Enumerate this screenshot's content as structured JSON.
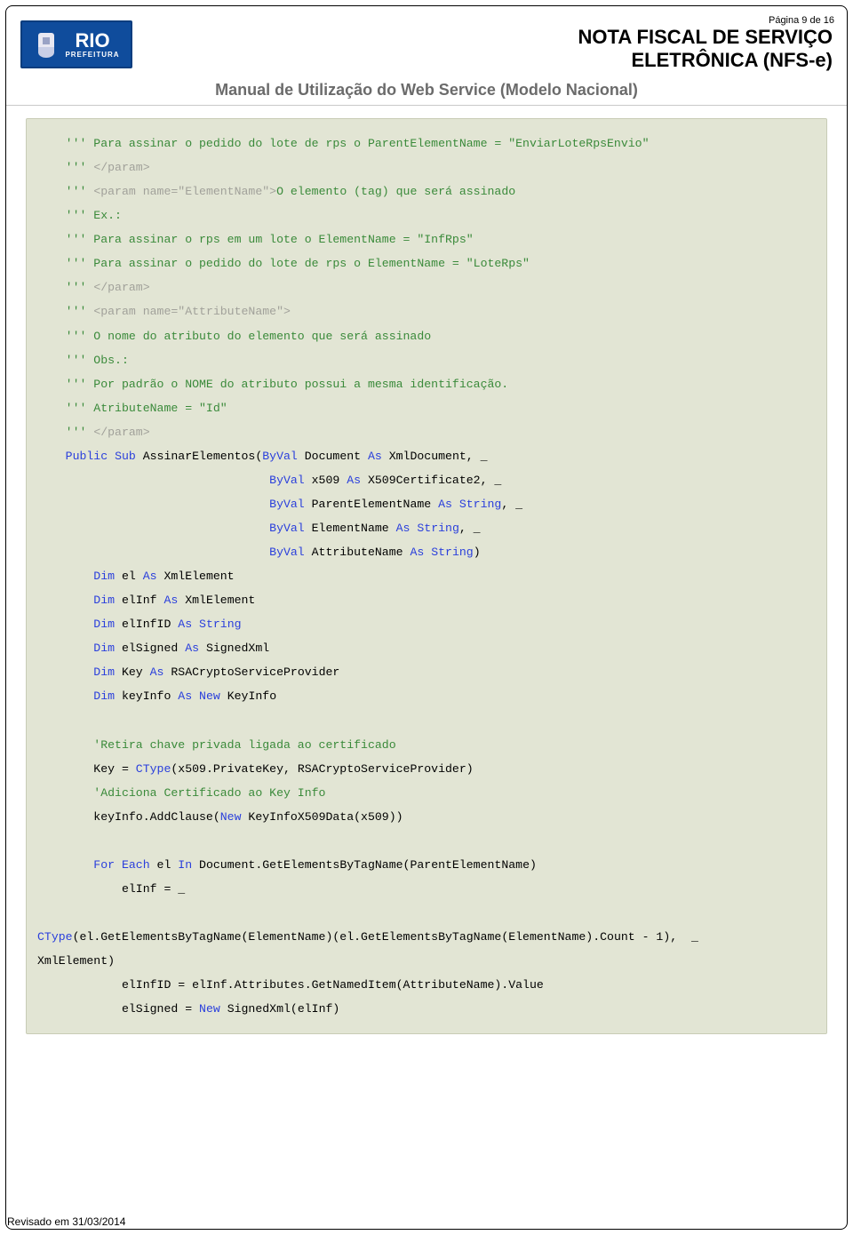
{
  "page_label": "Página 9 de 16",
  "logo": {
    "rio": "RIO",
    "pref": "PREFEITURA"
  },
  "title": {
    "line1": "NOTA FISCAL DE SERVIÇO",
    "line2": "ELETRÔNICA (NFS-e)"
  },
  "subtitle": "Manual de Utilização do Web Service (Modelo Nacional)",
  "footer": "Revisado em 31/03/2014",
  "code": {
    "l01": "    ''' Para assinar o pedido do lote de rps o ParentElementName = \"EnviarLoteRpsEnvio\"",
    "l02a": "    '''",
    "l02b": " </param>",
    "l03a": "    '''",
    "l03b": " <param name=\"ElementName\">",
    "l03c": "O elemento (tag) que será assinado",
    "l04": "    ''' Ex.:",
    "l05": "    ''' Para assinar o rps em um lote o ElementName = \"InfRps\"",
    "l06": "    ''' Para assinar o pedido do lote de rps o ElementName = \"LoteRps\"",
    "l07a": "    '''",
    "l07b": " </param>",
    "l08a": "    '''",
    "l08b": " <param name=\"AttributeName\">",
    "l09": "    ''' O nome do atributo do elemento que será assinado",
    "l10": "    ''' Obs.:",
    "l11": "    ''' Por padrão o NOME do atributo possui a mesma identificação.",
    "l12": "    ''' AtributeName = \"Id\"",
    "l13a": "    '''",
    "l13b": " </param>",
    "kw_public": "    Public",
    "kw_sub": "Sub",
    "sig_name": " AssinarElementos(",
    "kw_byval": "ByVal",
    "kw_as": "As",
    "sig_doc1": " Document ",
    "sig_doc2": " XmlDocument, _",
    "indent_sig": "                                 ",
    "sig_x509a": " x509 ",
    "sig_x509b": " X509Certificate2, _",
    "sig_p1": " ParentElementName ",
    "kw_string": "String",
    "sig_tail": ", _",
    "sig_e1": " ElementName ",
    "sig_a1": " AttributeName ",
    "sig_close": ")",
    "kw_dim": "        Dim",
    "d1a": " el ",
    "d1b": " XmlElement",
    "d2a": " elInf ",
    "d3a": " elInfID ",
    "d4a": " elSigned ",
    "d4b": " SignedXml",
    "d5a": " Key ",
    "d5b": " RSACryptoServiceProvider",
    "d6a": " keyInfo ",
    "kw_new": "New",
    "d6b": " KeyInfo",
    "blank": "",
    "cmt_retira": "        'Retira chave privada ligada ao certificado",
    "key_assign1": "        Key = ",
    "kw_ctype": "CType",
    "key_assign2": "(x509.PrivateKey, RSACryptoServiceProvider)",
    "cmt_adiciona": "        'Adiciona Certificado ao Key Info",
    "add_clause1": "        keyInfo.AddClause(",
    "add_clause2": " KeyInfoX509Data(x509))",
    "kw_for": "        For",
    "kw_each": "Each",
    "for1": " el ",
    "kw_in": "In",
    "for2": " Document.GetElementsByTagName(ParentElementName)",
    "elinf_assign": "            elInf = _",
    "ctype_long": "(el.GetElementsByTagName(ElementName)(el.GetElementsByTagName(ElementName).Count - 1),  _",
    "xmlel_line": "XmlElement)",
    "elinfid_line": "            elInfID = elInf.Attributes.GetNamedItem(AttributeName).Value",
    "elsigned1": "            elSigned = ",
    "elsigned2": " SignedXml(elInf)"
  }
}
